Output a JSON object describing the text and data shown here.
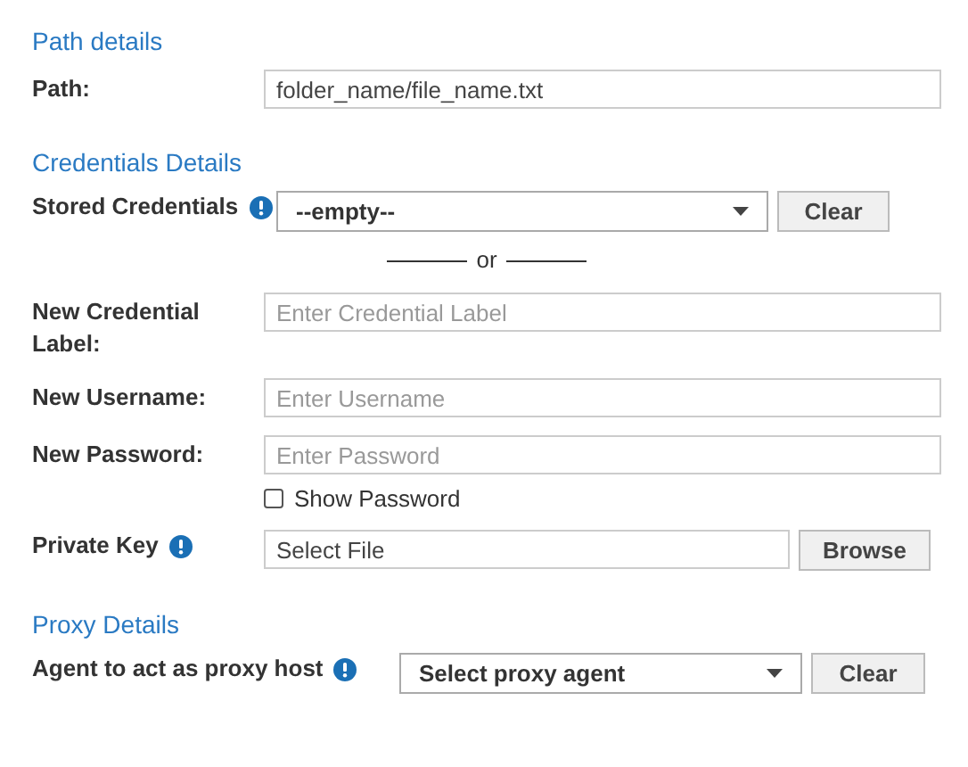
{
  "sections": [
    {
      "title": "Path details",
      "fields": [
        {
          "kind": "text",
          "label": "Path:",
          "value": "folder_name/file_name.txt"
        }
      ]
    },
    {
      "title": "Credentials Details",
      "fields": [
        {
          "kind": "select",
          "label": "Stored Credentials",
          "info": true,
          "value": "--empty--",
          "button": "Clear"
        },
        {
          "kind": "divider",
          "text": "or"
        },
        {
          "kind": "text",
          "label": "New Credential Label:",
          "placeholder": "Enter Credential Label"
        },
        {
          "kind": "text",
          "label": "New Username:",
          "placeholder": "Enter Username"
        },
        {
          "kind": "text",
          "label": "New Password:",
          "placeholder": "Enter Password"
        },
        {
          "kind": "checkbox",
          "label": "Show Password",
          "checked": false
        },
        {
          "kind": "file",
          "label": "Private Key",
          "info": true,
          "value": "Select File",
          "button": "Browse"
        }
      ]
    },
    {
      "title": "Proxy Details",
      "fields": [
        {
          "kind": "select",
          "label": "Agent to act as proxy host",
          "info": true,
          "value": "Select proxy agent",
          "button": "Clear"
        }
      ]
    }
  ]
}
